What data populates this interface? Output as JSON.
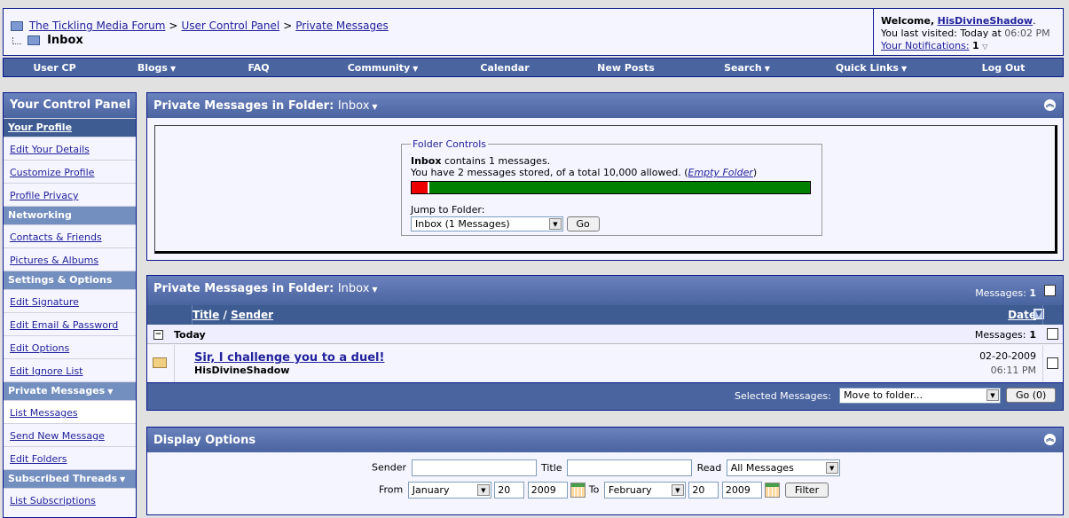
{
  "header": {
    "breadcrumb": [
      "The Tickling Media Forum",
      "User Control Panel",
      "Private Messages"
    ],
    "breadcrumb_sep": ">",
    "page_title": "Inbox",
    "welcome_label": "Welcome,",
    "username": "HisDivineShadow",
    "last_visited_label": "You last visited: Today at",
    "last_visited_time": "06:02 PM",
    "notifications_label": "Your Notifications:",
    "notifications_count": "1"
  },
  "navbar": {
    "items": [
      {
        "label": "User CP",
        "has_menu": false
      },
      {
        "label": "Blogs",
        "has_menu": true
      },
      {
        "label": "FAQ",
        "has_menu": false
      },
      {
        "label": "Community",
        "has_menu": true
      },
      {
        "label": "Calendar",
        "has_menu": false
      },
      {
        "label": "New Posts",
        "has_menu": false
      },
      {
        "label": "Search",
        "has_menu": true
      },
      {
        "label": "Quick Links",
        "has_menu": true
      },
      {
        "label": "Log Out",
        "has_menu": false
      }
    ]
  },
  "sidebar": {
    "title": "Your Control Panel",
    "sections": [
      {
        "label": "Your Profile",
        "items": [
          "Edit Your Details",
          "Customize Profile",
          "Profile Privacy"
        ]
      },
      {
        "label": "Networking",
        "items": [
          "Contacts & Friends",
          "Pictures & Albums"
        ]
      },
      {
        "label": "Settings & Options",
        "items": [
          "Edit Signature",
          "Edit Email & Password",
          "Edit Options",
          "Edit Ignore List"
        ]
      },
      {
        "label": "Private Messages",
        "items": [
          "List Messages",
          "Send New Message",
          "Edit Folders"
        ]
      },
      {
        "label": "Subscribed Threads",
        "items": [
          "List Subscriptions"
        ]
      }
    ]
  },
  "folder_panel": {
    "title": "Private Messages in Folder:",
    "folder": "Inbox",
    "legend": "Folder Controls",
    "contains_folder": "Inbox",
    "contains_text": "contains 1 messages.",
    "stored_text": "You have 2 messages stored, of a total 10,000 allowed. (",
    "empty_folder": "Empty Folder",
    "stored_close": ")",
    "quota_used_fraction": 0.045,
    "jump_label": "Jump to Folder:",
    "jump_value": "Inbox (1 Messages)",
    "go_label": "Go"
  },
  "messages_panel": {
    "title": "Private Messages in Folder:",
    "folder": "Inbox",
    "count_label": "Messages:",
    "count": "1",
    "col_title": "Title",
    "col_sep": "/",
    "col_sender": "Sender",
    "col_date": "Date",
    "group_label": "Today",
    "group_count_label": "Messages:",
    "group_count": "1",
    "message": {
      "title": "Sir, I challenge you to a duel!",
      "sender": "HisDivineShadow",
      "date": "02-20-2009",
      "time": "06:11 PM"
    },
    "selected_label": "Selected Messages:",
    "action_value": "Move to folder...",
    "go_label": "Go (0)"
  },
  "display_options": {
    "title": "Display Options",
    "sender_label": "Sender",
    "title_label": "Title",
    "read_label": "Read",
    "read_value": "All Messages",
    "from_label": "From",
    "from_month": "January",
    "from_day": "20",
    "from_year": "2009",
    "to_label": "To",
    "to_month": "February",
    "to_day": "20",
    "to_year": "2009",
    "filter_label": "Filter"
  },
  "colors": {
    "nav_bg": "#4a64a0",
    "border": "#0b198c",
    "link": "#22229c",
    "quota_used": "#ee0000",
    "quota_free": "#008000"
  }
}
